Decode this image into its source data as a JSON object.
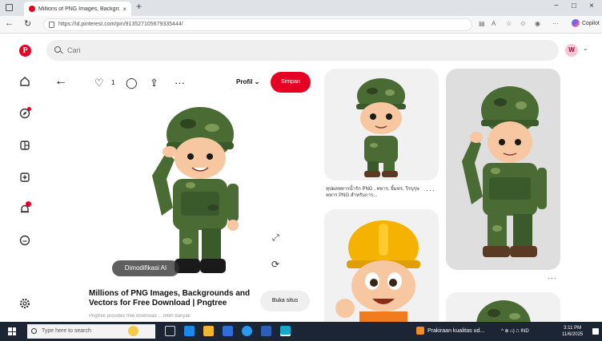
{
  "browser": {
    "tab_title": "Millions of PNG Images, Backgrounds...",
    "tab_close": "×",
    "new_tab": "+",
    "url": "https://id.pinterest.com/pin/913527105679335444/",
    "copilot_label": "Copilot",
    "win_minimize": "−",
    "win_restore": "□",
    "win_close": "×"
  },
  "header": {
    "logo": "P",
    "search_placeholder": "Cari",
    "avatar_initial": "W"
  },
  "rail": {
    "icons": [
      "home-icon",
      "explore-icon",
      "board-icon",
      "create-icon",
      "notifications-icon",
      "messages-icon",
      "settings-icon"
    ]
  },
  "pin": {
    "like_count": "1",
    "profile_label": "Profil ⌄",
    "save_label": "Simpan",
    "modified_label": "Dimodifikasi AI",
    "title": "Millions of PNG Images, Backgrounds and Vectors for Free Download | Pngtree",
    "subtitle": "Pngtree provides free download ... lebih banyak",
    "visit_label": "Buka situs"
  },
  "feed": {
    "caption": "ทุปผลทหารน้ำรัก PNG , ทหาร, ยิ้มทร, วีรบุรุษทหาร PNG สำหรับการ...",
    "more": "···"
  },
  "taskbar": {
    "search_placeholder": "Type here to search",
    "weather_text": "Prakiraan kualitas ud...",
    "tray_text": "^  ⊕  ⌂)  ⎍  IND",
    "time": "3:11 PM",
    "date": "11/6/2025"
  },
  "colors": {
    "brand": "#e60023",
    "taskbar": "#1c2533",
    "camo_dark": "#3b5a2c",
    "camo_light": "#7c9a56"
  }
}
